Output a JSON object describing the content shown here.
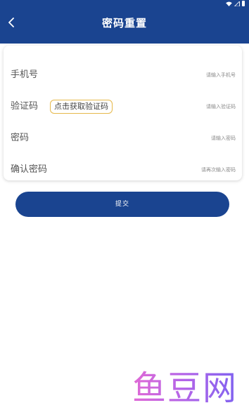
{
  "header": {
    "title": "密码重置"
  },
  "form": {
    "phone": {
      "label": "手机号",
      "placeholder": "请输入手机号"
    },
    "code": {
      "label": "验证码",
      "button": "点击获取验证码",
      "placeholder": "请输入验证码"
    },
    "password": {
      "label": "密码",
      "placeholder": "请输入密码"
    },
    "confirm": {
      "label": "确认密码",
      "placeholder": "请再次输入密码"
    }
  },
  "submit_label": "提交",
  "watermark": "鱼豆网",
  "colors": {
    "primary": "#1a4490",
    "accent_border": "#e6b84a"
  },
  "icons": [
    "back-arrow-icon",
    "wifi-icon",
    "signal-icon",
    "battery-icon"
  ]
}
